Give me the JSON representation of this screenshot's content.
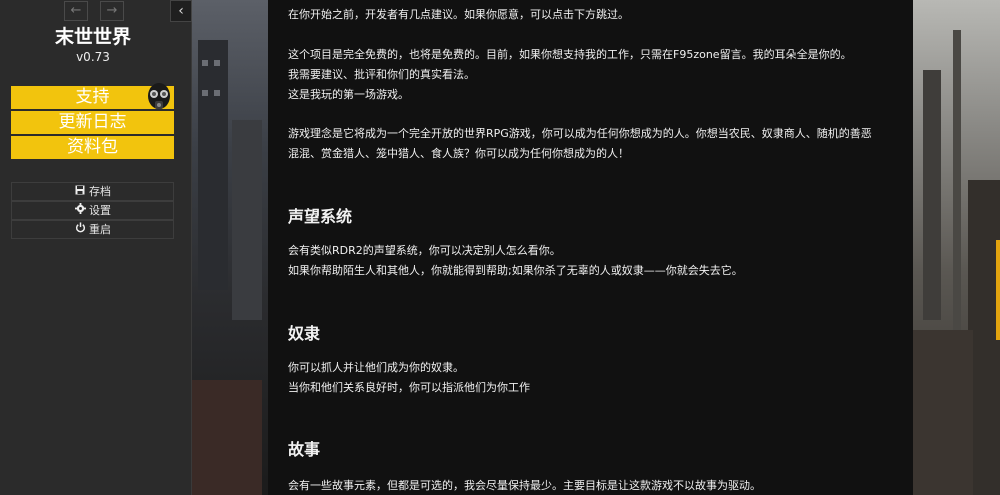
{
  "sidebar": {
    "history_back_icon": "←",
    "history_forward_icon": "→",
    "collapse_icon": "‹",
    "title": "末世世界",
    "version": "v0.73",
    "links": [
      {
        "label": "支持"
      },
      {
        "label": "更新日志"
      },
      {
        "label": "资料包"
      }
    ],
    "menu": [
      {
        "label": "存档",
        "icon": "save-icon"
      },
      {
        "label": "设置",
        "icon": "gear-icon"
      },
      {
        "label": "重启",
        "icon": "power-icon"
      }
    ]
  },
  "passage": {
    "intro": "在你开始之前，开发者有几点建议。如果你愿意，可以点击下方跳过。",
    "free_line1": "这个项目是完全免费的，也将是免费的。目前，如果你想支持我的工作，只需在F95zone留言。我的耳朵全是你的。",
    "free_line2": "我需要建议、批评和你们的真实看法。",
    "free_line3": "这是我玩的第一场游戏。",
    "concept_line1": "游戏理念是它将成为一个完全开放的世界RPG游戏，你可以成为任何你想成为的人。你想当农民、奴隶商人、随机的善恶",
    "concept_line2": "混混、赏金猎人、笼中猎人、食人族？你可以成为任何你想成为的人！",
    "rep_heading": "声望系统",
    "rep_line1": "会有类似RDR2的声望系统，你可以决定别人怎么看你。",
    "rep_line2": "如果你帮助陌生人和其他人，你就能得到帮助;如果你杀了无辜的人或奴隶——你就会失去它。",
    "slave_heading": "奴隶",
    "slave_line1": "你可以抓人并让他们成为你的奴隶。",
    "slave_line2": "当你和他们关系良好时，你可以指派他们为你工作",
    "story_heading": "故事",
    "story_line1": "会有一些故事元素，但都是可选的，我会尽量保持最少。主要目标是让这款游戏不以故事为驱动。"
  },
  "colors": {
    "accent_yellow": "#f2c40d",
    "sidebar_bg": "#2b2b2b",
    "passage_bg": "#111111"
  }
}
